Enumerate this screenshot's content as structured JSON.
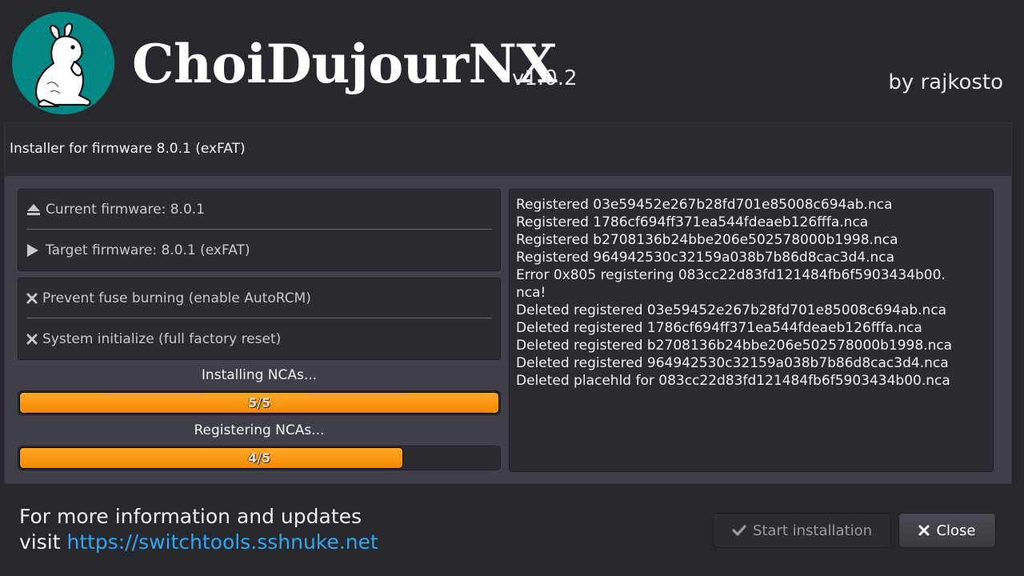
{
  "app": {
    "title": "ChoiDujourNX",
    "version": "v1.0.2",
    "author": "by rajkosto",
    "logo_icon": "rabbit-logo-icon",
    "logo_color": "#038886"
  },
  "header": {
    "subtitle": "Installer for firmware 8.0.1 (exFAT)"
  },
  "firmware": {
    "current_label": "Current firmware: 8.0.1",
    "current_icon": "eject-icon",
    "target_label": "Target firmware: 8.0.1 (exFAT)",
    "target_icon": "play-icon"
  },
  "options": {
    "autorcm_label": "Prevent fuse burning (enable AutoRCM)",
    "autorcm_icon": "close-x-icon",
    "factory_reset_label": "System initialize (full factory reset)",
    "factory_reset_icon": "close-x-icon"
  },
  "progress": [
    {
      "label": "Installing NCAs...",
      "text": "5/5",
      "fraction": 1.0
    },
    {
      "label": "Registering NCAs...",
      "text": "4/5",
      "fraction": 0.8
    }
  ],
  "log": [
    "Registered 03e59452e267b28fd701e85008c694ab.nca",
    "Registered 1786cf694ff371ea544fdeaeb126fffa.nca",
    "Registered b2708136b24bbe206e502578000b1998.nca",
    "Registered 964942530c32159a038b7b86d8cac3d4.nca",
    "Error 0x805 registering 083cc22d83fd121484fb6f5903434b00.",
    "nca!",
    "Deleted registered 03e59452e267b28fd701e85008c694ab.nca",
    "Deleted registered 1786cf694ff371ea544fdeaeb126fffa.nca",
    "Deleted registered b2708136b24bbe206e502578000b1998.nca",
    "Deleted registered 964942530c32159a038b7b86d8cac3d4.nca",
    "Deleted placehld for 083cc22d83fd121484fb6f5903434b00.nca"
  ],
  "footer": {
    "info_line1": "For more information and updates",
    "info_visit": "visit",
    "info_link": "https://switchtools.sshnuke.net",
    "link_color": "#2fa6ef"
  },
  "buttons": {
    "start_label": "Start installation",
    "start_icon": "checkmark-icon",
    "close_label": "Close",
    "close_icon": "close-x-icon"
  },
  "colors": {
    "background": "#27282e",
    "panel": "#3f4047",
    "progress_fill": "#f7940c"
  }
}
